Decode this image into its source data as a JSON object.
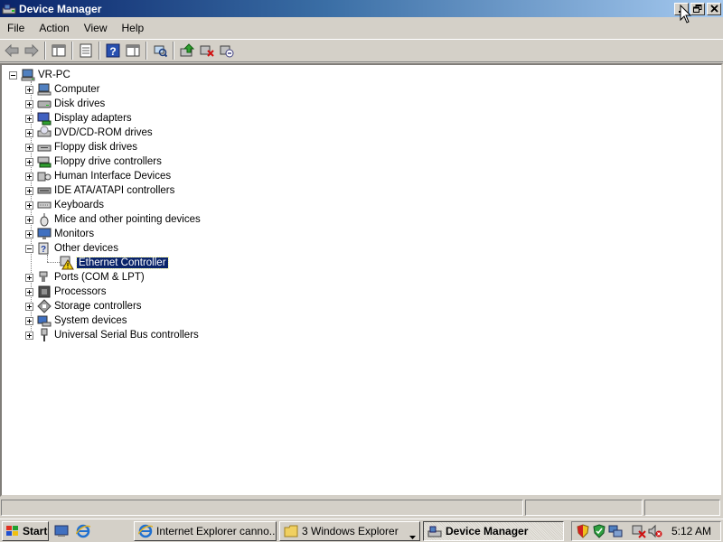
{
  "window": {
    "title": "Device Manager",
    "app_icon": "device-manager-icon"
  },
  "menu": [
    "File",
    "Action",
    "View",
    "Help"
  ],
  "toolbar": {
    "buttons": [
      "back-icon",
      "forward-icon",
      "show-hide-tree-icon",
      "properties-icon",
      "help-icon",
      "show-hide-action-pane-icon",
      "scan-hardware-changes-icon",
      "update-driver-icon",
      "uninstall-icon",
      "disable-icon"
    ]
  },
  "tree": {
    "root": "VR-PC",
    "categories": [
      {
        "label": "Computer",
        "icon": "computer-icon"
      },
      {
        "label": "Disk drives",
        "icon": "disk-drive-icon"
      },
      {
        "label": "Display adapters",
        "icon": "display-adapter-icon"
      },
      {
        "label": "DVD/CD-ROM drives",
        "icon": "dvd-drive-icon"
      },
      {
        "label": "Floppy disk drives",
        "icon": "floppy-disk-icon"
      },
      {
        "label": "Floppy drive controllers",
        "icon": "floppy-controller-icon"
      },
      {
        "label": "Human Interface Devices",
        "icon": "hid-icon"
      },
      {
        "label": "IDE ATA/ATAPI controllers",
        "icon": "ide-controller-icon"
      },
      {
        "label": "Keyboards",
        "icon": "keyboard-icon"
      },
      {
        "label": "Mice and other pointing devices",
        "icon": "mouse-icon"
      },
      {
        "label": "Monitors",
        "icon": "monitor-icon"
      },
      {
        "label": "Other devices",
        "icon": "unknown-device-icon",
        "expanded": true
      },
      {
        "label": "Ethernet Controller",
        "icon": "warning-device-icon",
        "child": true,
        "selected": true
      },
      {
        "label": "Ports (COM & LPT)",
        "icon": "port-icon"
      },
      {
        "label": "Processors",
        "icon": "processor-icon"
      },
      {
        "label": "Storage controllers",
        "icon": "storage-controller-icon"
      },
      {
        "label": "System devices",
        "icon": "system-device-icon"
      },
      {
        "label": "Universal Serial Bus controllers",
        "icon": "usb-icon"
      }
    ]
  },
  "taskbar": {
    "start_label": "Start",
    "tasks": [
      {
        "label": "Internet Explorer canno...",
        "icon": "internet-explorer-icon"
      },
      {
        "label": "3 Windows Explorer",
        "icon": "folder-icon"
      },
      {
        "label": "Device Manager",
        "icon": "device-manager-icon",
        "active": true
      }
    ],
    "clock": "5:12 AM"
  }
}
